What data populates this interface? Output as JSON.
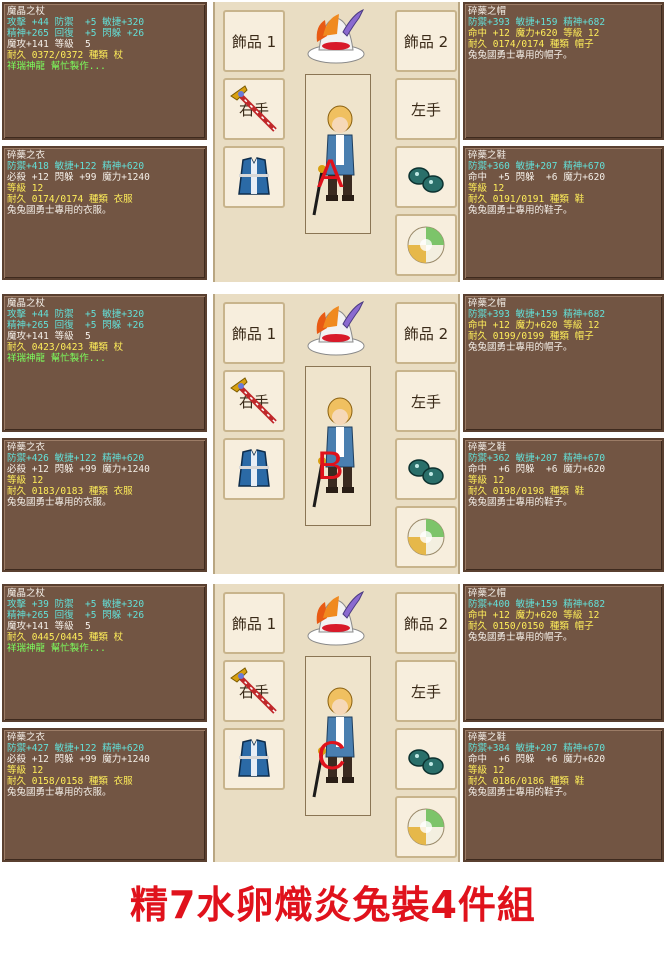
{
  "panels": [
    {
      "letter": "A",
      "staff": [
        "魔晶之杖",
        "攻擊 +44 防禦  +5 敏捷+320",
        "精神+265 回復  +5 閃躲 +26",
        "魔攻+141 等級  5",
        "耐久 0372/0372 種類 杖",
        "祥瑞神龍 幫忙製作..."
      ],
      "clothes": [
        "碎藥之衣",
        "防禦+418 敏捷+122 精神+620",
        "必殺 +12 閃躲 +99 魔力+1240",
        "等級 12",
        "耐久 0174/0174 種類 衣服",
        "兔兔國勇士專用的衣服。"
      ],
      "hat": [
        "碎藥之帽",
        "防禦+393 敏捷+159 精神+682",
        "命中 +12 魔力+620 等級 12",
        "耐久 0174/0174 種類 帽子",
        "兔兔國勇士專用的帽子。"
      ],
      "shoes": [
        "碎藥之鞋",
        "防禦+360 敏捷+207 精神+670",
        "命中  +5 閃躲  +6 魔力+620",
        "等級 12",
        "耐久 0191/0191 種類 鞋",
        "兔兔國勇士專用的鞋子。"
      ]
    },
    {
      "letter": "B",
      "staff": [
        "魔晶之杖",
        "攻擊 +44 防禦  +5 敏捷+320",
        "精神+265 回復  +5 閃躲 +26",
        "魔攻+141 等級  5",
        "耐久 0423/0423 種類 杖",
        "祥瑞神龍 幫忙製作..."
      ],
      "clothes": [
        "碎藥之衣",
        "防禦+426 敏捷+122 精神+620",
        "必殺 +12 閃躲 +99 魔力+1240",
        "等級 12",
        "耐久 0183/0183 種類 衣服",
        "兔兔國勇士專用的衣服。"
      ],
      "hat": [
        "碎藥之帽",
        "防禦+393 敏捷+159 精神+682",
        "命中 +12 魔力+620 等級 12",
        "耐久 0199/0199 種類 帽子",
        "兔兔國勇士專用的帽子。"
      ],
      "shoes": [
        "碎藥之鞋",
        "防禦+362 敏捷+207 精神+670",
        "命中  +6 閃躲  +6 魔力+620",
        "等級 12",
        "耐久 0198/0198 種類 鞋",
        "兔兔國勇士專用的鞋子。"
      ]
    },
    {
      "letter": "C",
      "staff": [
        "魔晶之杖",
        "攻擊 +39 防禦  +5 敏捷+320",
        "精神+265 回復  +5 閃躲 +26",
        "魔攻+141 等級  5",
        "耐久 0445/0445 種類 杖",
        "祥瑞神龍 幫忙製作..."
      ],
      "clothes": [
        "碎藥之衣",
        "防禦+427 敏捷+122 精神+620",
        "必殺 +12 閃躲 +99 魔力+1240",
        "等級 12",
        "耐久 0158/0158 種類 衣服",
        "兔兔國勇士專用的衣服。"
      ],
      "hat": [
        "碎藥之帽",
        "防禦+400 敏捷+159 精神+682",
        "命中 +12 魔力+620 等級 12",
        "耐久 0150/0150 種類 帽子",
        "兔兔國勇士專用的帽子。"
      ],
      "shoes": [
        "碎藥之鞋",
        "防禦+384 敏捷+207 精神+670",
        "命中  +6 閃躲  +6 魔力+620",
        "等級 12",
        "耐久 0186/0186 種類 鞋",
        "兔兔國勇士專用的鞋子。"
      ]
    }
  ],
  "slots": {
    "accessory1": "飾品 1",
    "accessory2": "飾品 2",
    "right_hand": "右手",
    "left_hand": "左手"
  },
  "caption": "精7水卵熾炎兔裝4件組",
  "colors": {
    "panel_bg": "#725543",
    "stat_cyan": "#63e0d8",
    "level_yellow": "#ffee5a",
    "maker_green": "#7cff5c",
    "caption_red": "#e0121c"
  }
}
